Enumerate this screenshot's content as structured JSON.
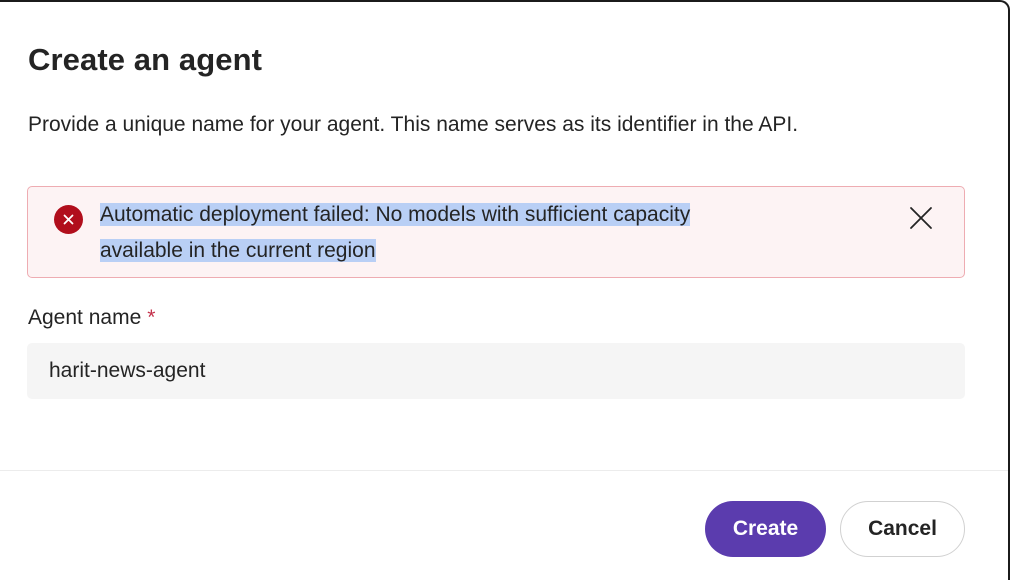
{
  "dialog": {
    "title": "Create an agent",
    "description": "Provide a unique name for your agent. This name serves as its identifier in the API."
  },
  "error": {
    "message_line1": "Automatic deployment failed: No models with sufficient capacity",
    "message_line2": "available in the current region",
    "icon": "error-circle-icon",
    "dismiss_icon": "close-icon",
    "color": "#b10e1c"
  },
  "form": {
    "agent_name_label": "Agent name",
    "required_marker": "*",
    "agent_name_value": "harit-news-agent"
  },
  "footer": {
    "create_label": "Create",
    "cancel_label": "Cancel",
    "accent_color": "#5b3cae"
  }
}
